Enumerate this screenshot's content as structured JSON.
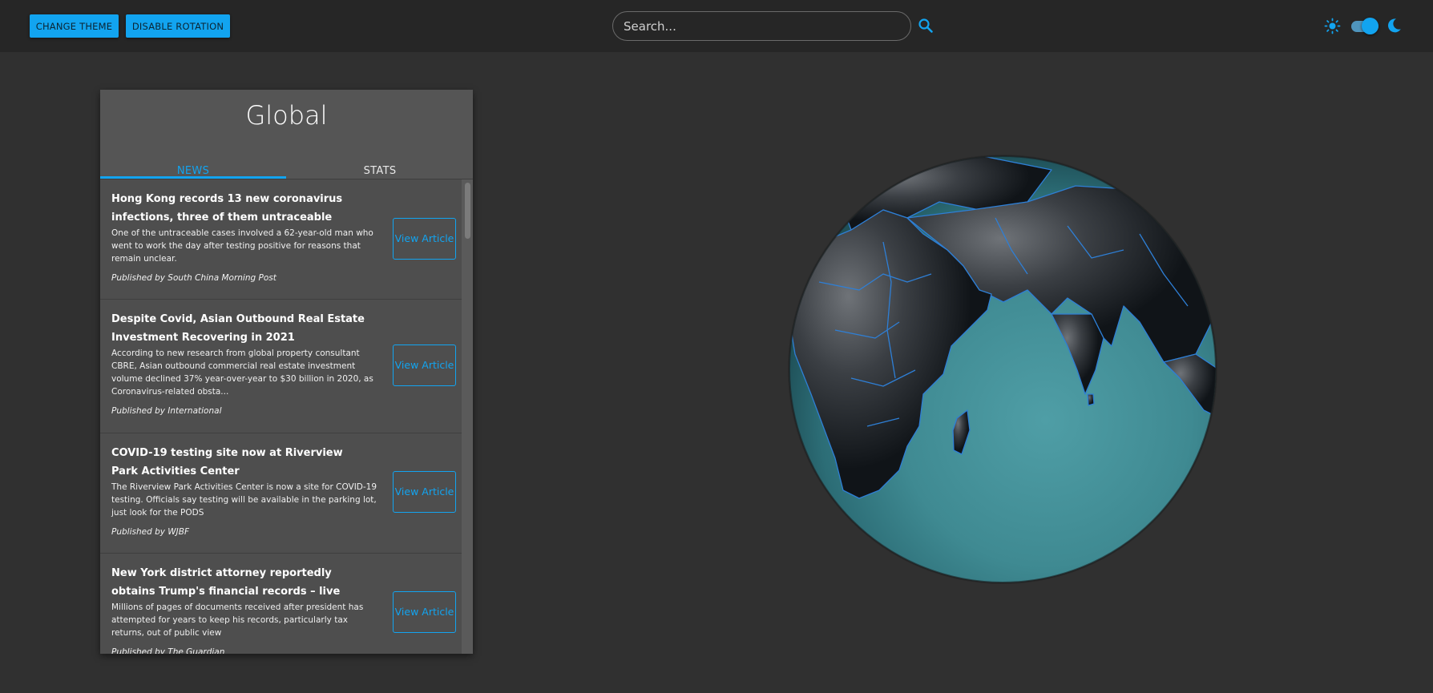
{
  "toolbar": {
    "change_theme_label": "CHANGE THEME",
    "disable_rotation_label": "DISABLE ROTATION"
  },
  "search": {
    "placeholder": "Search...",
    "icon": "search-icon"
  },
  "theme_toggle": {
    "light_icon": "sun-icon",
    "dark_icon": "moon-icon",
    "state": "dark"
  },
  "panel": {
    "title": "Global",
    "tabs": [
      {
        "label": "NEWS",
        "active": true
      },
      {
        "label": "STATS",
        "active": false
      }
    ],
    "articles": [
      {
        "title": "Hong Kong records 13 new coronavirus infections, three of them untraceable",
        "description": "One of the untraceable cases involved a 62-year-old man who went to work the day after testing positive for reasons that remain unclear.",
        "publisher": "Published by South China Morning Post",
        "button_label": "View Article"
      },
      {
        "title": "Despite Covid, Asian Outbound Real Estate Investment Recovering in 2021",
        "description": "According to new research from global property consultant CBRE, Asian outbound commercial real estate investment volume declined 37% year-over-year to $30 billion in 2020, as Coronavirus-related obsta...",
        "publisher": "Published by International",
        "button_label": "View Article"
      },
      {
        "title": "COVID-19 testing site now at Riverview Park Activities Center",
        "description": "The Riverview Park Activities Center is now a site for COVID-19 testing. Officials say testing will be available in the parking lot, just look for the PODS",
        "publisher": "Published by WJBF",
        "button_label": "View Article"
      },
      {
        "title": "New York district attorney reportedly obtains Trump's financial records – live",
        "description": "Millions of pages of documents received after president has attempted for years to keep his records, particularly tax returns, out of public view",
        "publisher": "Published by The Guardian",
        "button_label": "View Article"
      }
    ]
  },
  "colors": {
    "accent": "#12a4f0",
    "background": "#303030",
    "topbar": "#262626",
    "panel": "#555555"
  }
}
